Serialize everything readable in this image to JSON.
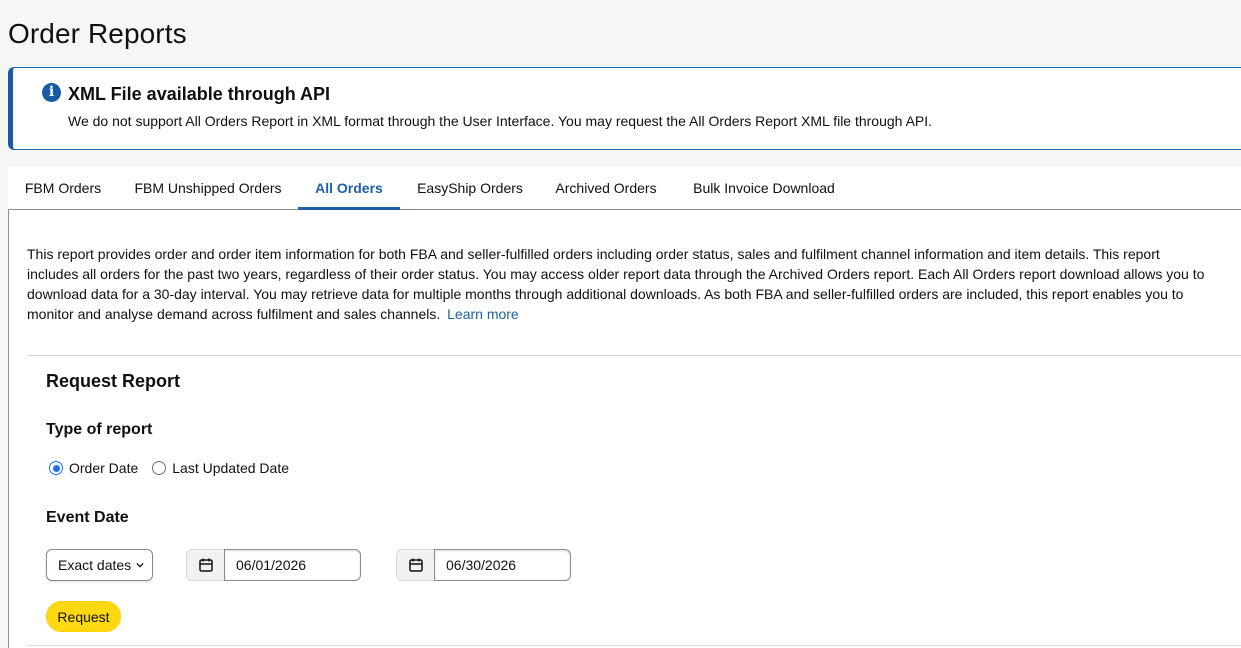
{
  "page": {
    "title": "Order Reports"
  },
  "alert": {
    "icon": "info-icon",
    "icon_glyph": "i",
    "title": "XML File available through API",
    "text": "We do not support All Orders Report in XML format through the User Interface. You may request the All Orders Report XML file through API."
  },
  "tabs": [
    {
      "label": "FBM Orders",
      "active": false
    },
    {
      "label": "FBM Unshipped Orders",
      "active": false
    },
    {
      "label": "All Orders",
      "active": true
    },
    {
      "label": "EasyShip Orders",
      "active": false
    },
    {
      "label": "Archived Orders",
      "active": false
    },
    {
      "label": "Bulk Invoice Download",
      "active": false
    }
  ],
  "description": {
    "text": "This report provides order and order item information for both FBA and seller-fulfilled orders including order status, sales and fulfilment channel information and item details. This report includes all orders for the past two years, regardless of their order status. You may access older report data through the Archived Orders report. Each All Orders report download allows you to download data for a 30-day interval. You may retrieve data for multiple months through additional downloads. As both FBA and seller-fulfilled orders are included, this report enables you to monitor and analyse demand across fulfilment and sales channels.",
    "link": "Learn more"
  },
  "request": {
    "title": "Request Report",
    "type_label": "Type of report",
    "options": [
      {
        "label": "Order Date",
        "checked": true
      },
      {
        "label": "Last Updated Date",
        "checked": false
      }
    ],
    "event_label": "Event Date",
    "date_mode": "Exact dates",
    "start_date": "06/01/2026",
    "end_date": "06/30/2026",
    "button": "Request"
  },
  "colors": {
    "accent": "#1f5fa7",
    "button": "#ffd814",
    "link": "#2162a1"
  }
}
